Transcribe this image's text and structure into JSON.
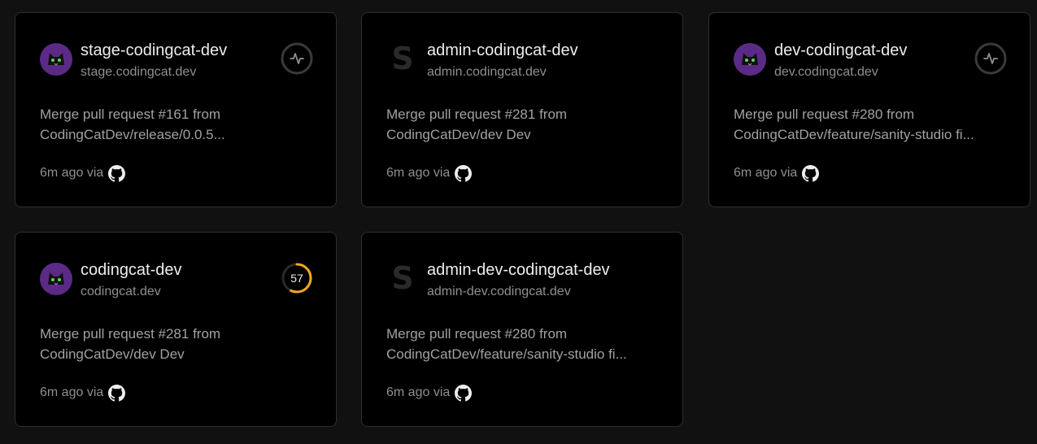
{
  "colors": {
    "background": "#111111",
    "card": "#000000",
    "border": "#2e2e2e",
    "score_ring": "#f5a623",
    "avatar_purple": "#5b2a86"
  },
  "projects": [
    {
      "name": "stage-codingcat-dev",
      "domain": "stage.codingcat.dev",
      "commit_line1": "Merge pull request #161 from",
      "commit_line2": "CodingCatDev/release/0.0.5...",
      "time": "6m ago via",
      "avatar_icon": "cat-avatar-icon",
      "status_icon": "activity-icon"
    },
    {
      "name": "admin-codingcat-dev",
      "domain": "admin.codingcat.dev",
      "commit_line1": "Merge pull request #281 from",
      "commit_line2": "CodingCatDev/dev Dev",
      "time": "6m ago via",
      "avatar_icon": "sanity-logo-icon"
    },
    {
      "name": "dev-codingcat-dev",
      "domain": "dev.codingcat.dev",
      "commit_line1": "Merge pull request #280 from",
      "commit_line2": "CodingCatDev/feature/sanity-studio fi...",
      "time": "6m ago via",
      "avatar_icon": "cat-avatar-icon",
      "status_icon": "activity-icon"
    },
    {
      "name": "codingcat-dev",
      "domain": "codingcat.dev",
      "commit_line1": "Merge pull request #281 from",
      "commit_line2": "CodingCatDev/dev Dev",
      "time": "6m ago via",
      "avatar_icon": "cat-avatar-icon",
      "score": "57",
      "score_fraction": 0.57
    },
    {
      "name": "admin-dev-codingcat-dev",
      "domain": "admin-dev.codingcat.dev",
      "commit_line1": "Merge pull request #280 from",
      "commit_line2": "CodingCatDev/feature/sanity-studio fi...",
      "time": "6m ago via",
      "avatar_icon": "sanity-logo-icon"
    }
  ]
}
